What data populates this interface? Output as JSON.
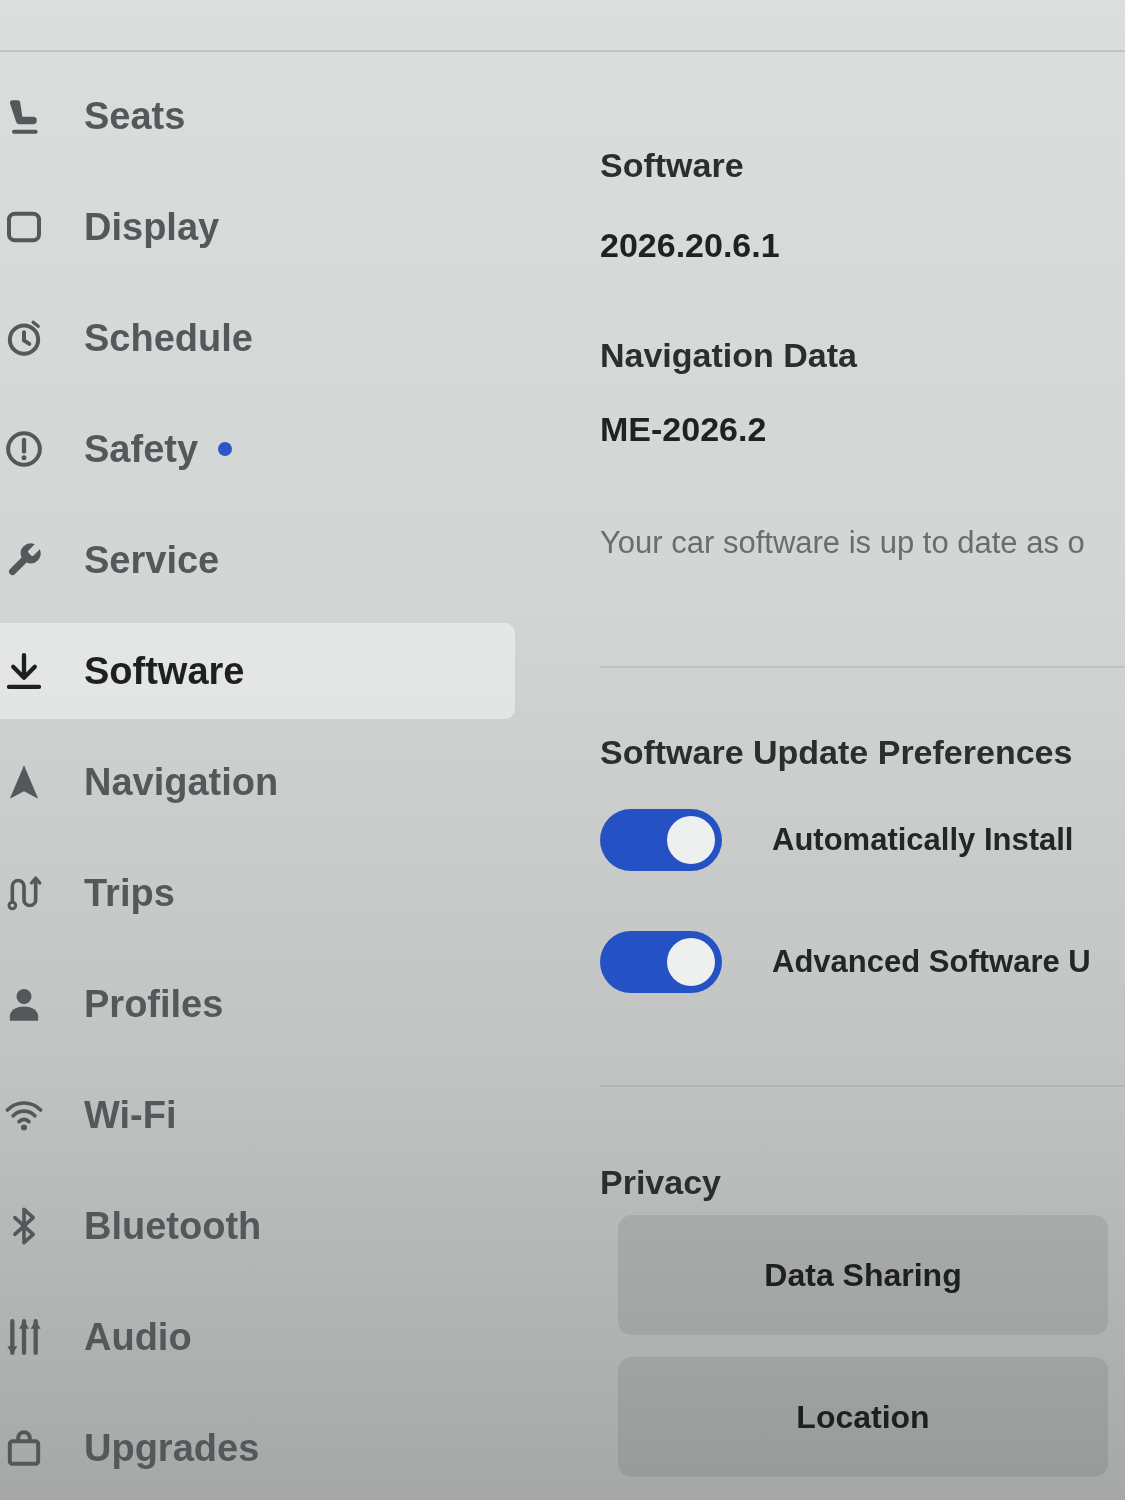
{
  "sidebar": {
    "items": [
      {
        "label": "Seats",
        "selected": false,
        "notification": false
      },
      {
        "label": "Display",
        "selected": false,
        "notification": false
      },
      {
        "label": "Schedule",
        "selected": false,
        "notification": false
      },
      {
        "label": "Safety",
        "selected": false,
        "notification": true
      },
      {
        "label": "Service",
        "selected": false,
        "notification": false
      },
      {
        "label": "Software",
        "selected": true,
        "notification": false
      },
      {
        "label": "Navigation",
        "selected": false,
        "notification": false
      },
      {
        "label": "Trips",
        "selected": false,
        "notification": false
      },
      {
        "label": "Profiles",
        "selected": false,
        "notification": false
      },
      {
        "label": "Wi-Fi",
        "selected": false,
        "notification": false
      },
      {
        "label": "Bluetooth",
        "selected": false,
        "notification": false
      },
      {
        "label": "Audio",
        "selected": false,
        "notification": false
      },
      {
        "label": "Upgrades",
        "selected": false,
        "notification": false
      }
    ]
  },
  "software": {
    "title": "Software",
    "version": "2026.20.6.1"
  },
  "navigation_data": {
    "title": "Navigation Data",
    "version": "ME-2026.2"
  },
  "status_text": "Your car software is up to date as o",
  "update_preferences": {
    "title": "Software Update Preferences",
    "toggles": [
      {
        "label": "Automatically Install",
        "on": true
      },
      {
        "label": "Advanced Software U",
        "on": true
      }
    ]
  },
  "privacy": {
    "title": "Privacy",
    "buttons": [
      "Data Sharing",
      "Location"
    ]
  }
}
